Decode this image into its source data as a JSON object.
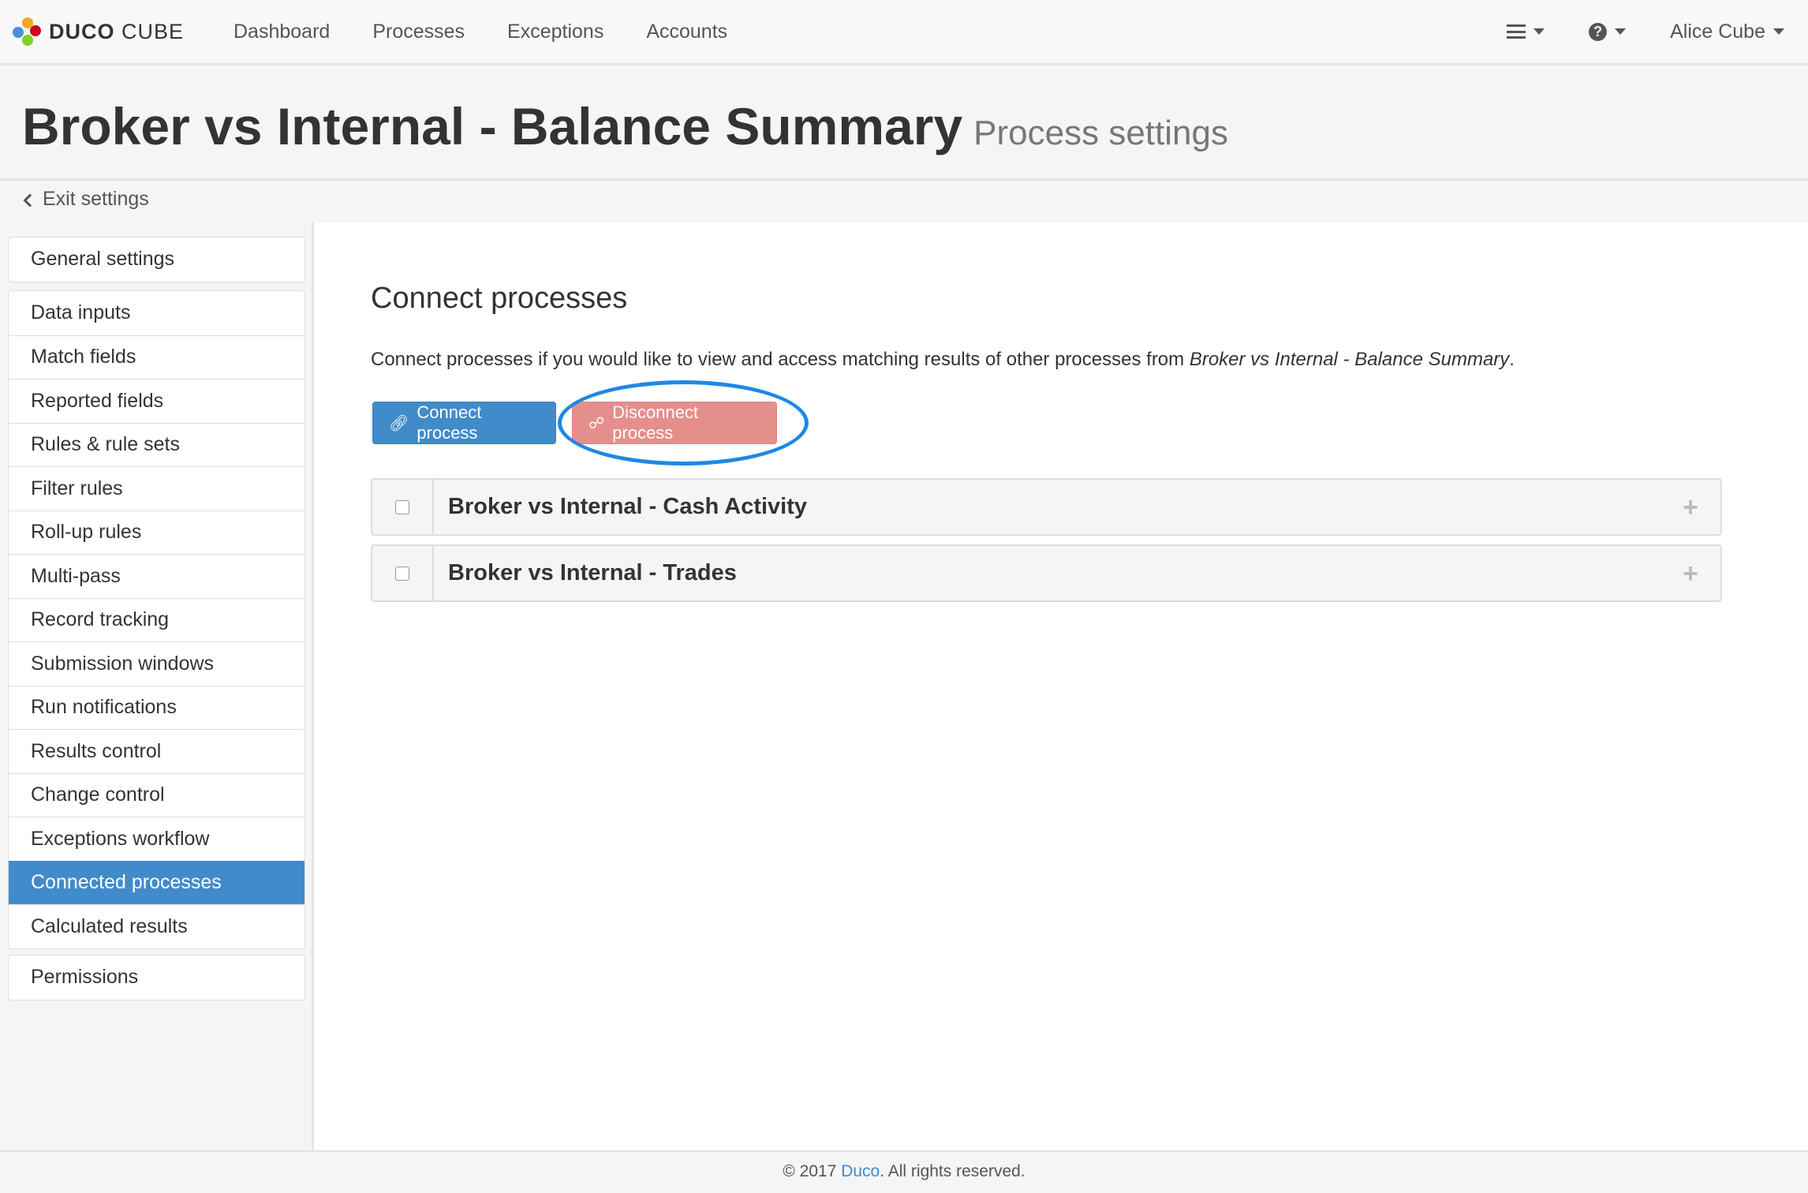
{
  "brand": {
    "name_bold": "DUCO",
    "name_rest": "CUBE"
  },
  "nav": {
    "links": [
      "Dashboard",
      "Processes",
      "Exceptions",
      "Accounts"
    ],
    "user": "Alice Cube",
    "help_glyph": "?"
  },
  "header": {
    "title": "Broker vs Internal - Balance Summary",
    "subtitle": "Process settings",
    "exit_label": "Exit settings"
  },
  "sidebar": {
    "group1": [
      "General settings"
    ],
    "group2": [
      "Data inputs",
      "Match fields",
      "Reported fields",
      "Rules & rule sets",
      "Filter rules",
      "Roll-up rules",
      "Multi-pass",
      "Record tracking",
      "Submission windows",
      "Run notifications",
      "Results control",
      "Change control",
      "Exceptions workflow",
      "Connected processes",
      "Calculated results"
    ],
    "group3": [
      "Permissions"
    ],
    "active": "Connected processes"
  },
  "main": {
    "heading": "Connect processes",
    "intro_prefix": "Connect processes if you would like to view and access matching results of other processes from ",
    "intro_process": "Broker vs Internal - Balance Summary",
    "intro_suffix": ".",
    "connect_label": "Connect process",
    "disconnect_label": "Disconnect process",
    "connected": [
      {
        "name": "Broker vs Internal - Cash Activity"
      },
      {
        "name": "Broker vs Internal - Trades"
      }
    ],
    "expand_glyph": "+"
  },
  "footer": {
    "prefix": "© 2017 ",
    "link": "Duco",
    "suffix": ". All rights reserved."
  },
  "colors": {
    "primary": "#428bca",
    "danger_light": "#e58f8d",
    "highlight_ring": "#1e88e5"
  }
}
